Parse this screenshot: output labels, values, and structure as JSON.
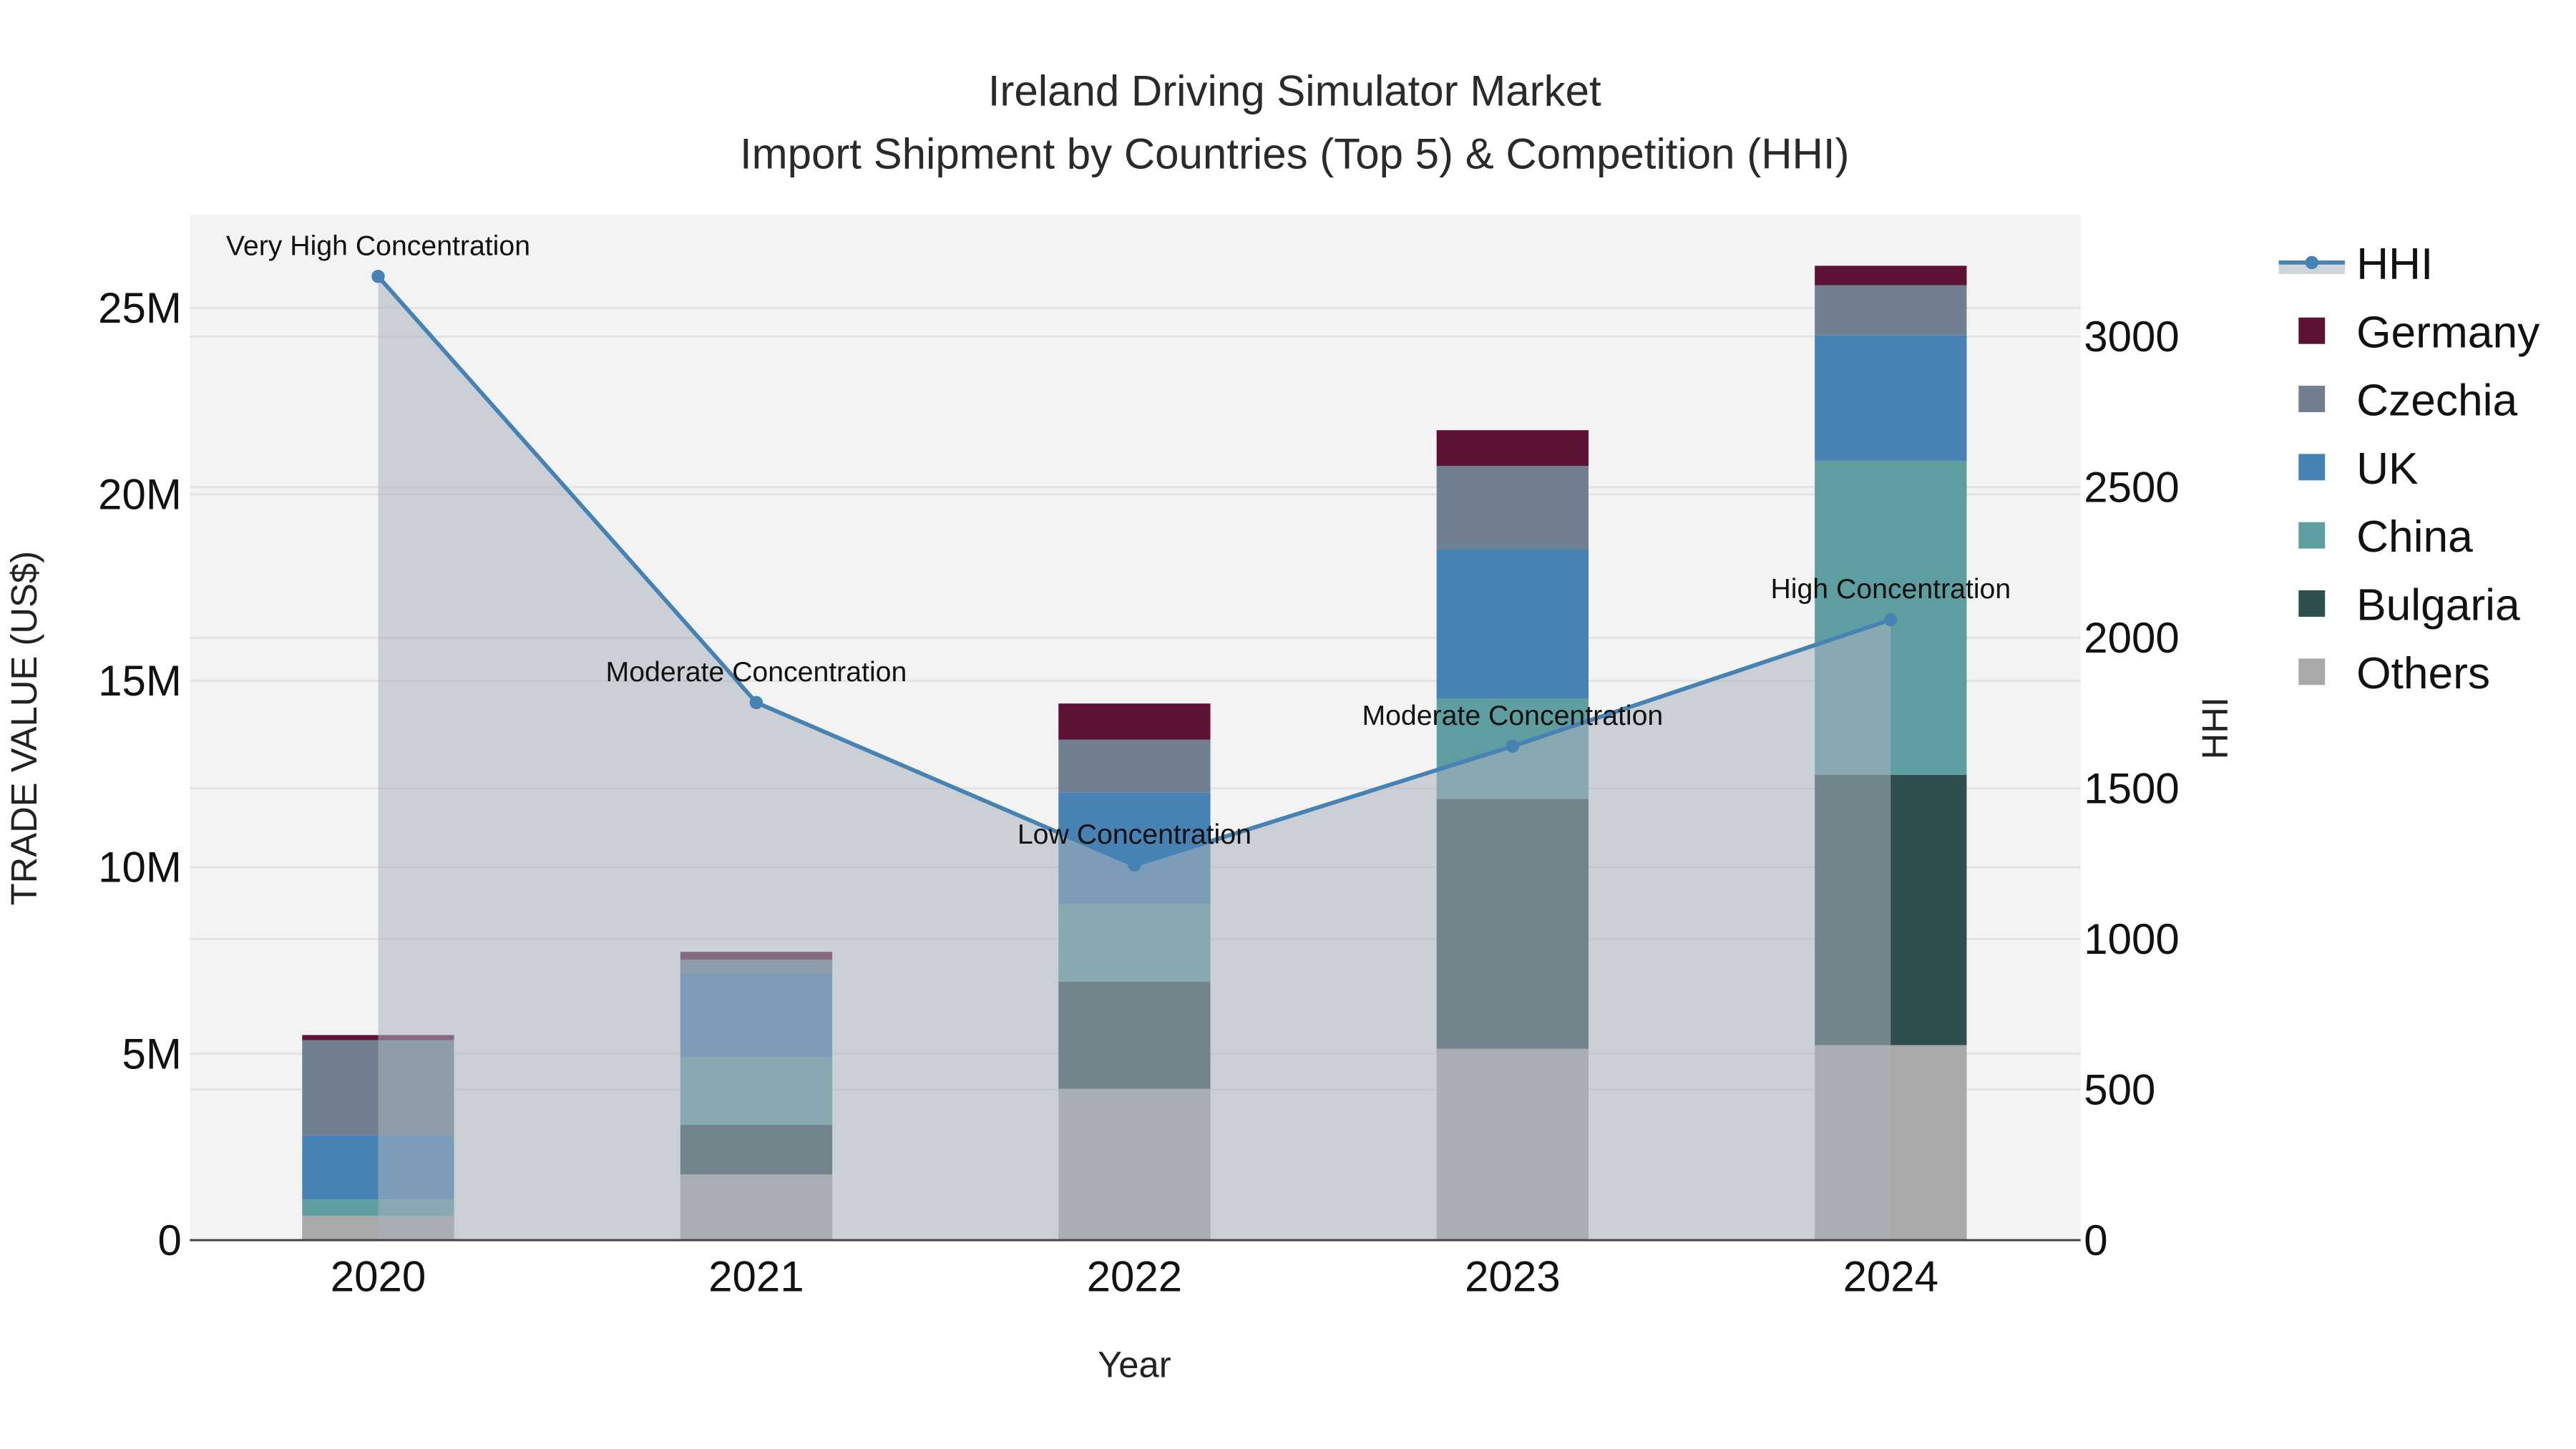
{
  "chart_data": {
    "type": "bar",
    "title": "Ireland Driving Simulator Market",
    "subtitle": "Import Shipment by Countries (Top 5) & Competition (HHI)",
    "xlabel": "Year",
    "ylabel": "TRADE VALUE (US$)",
    "y2label": "HHI",
    "categories": [
      "2020",
      "2021",
      "2022",
      "2023",
      "2024"
    ],
    "ylim": [
      0,
      27.5
    ],
    "y_unit": "M",
    "y_ticks": [
      0,
      5,
      10,
      15,
      20,
      25
    ],
    "y_tick_labels": [
      "0",
      "5M",
      "10M",
      "15M",
      "20M",
      "25M"
    ],
    "y2lim": [
      0,
      3405
    ],
    "y2_ticks": [
      0,
      500,
      1000,
      1500,
      2000,
      2500,
      3000
    ],
    "y2_tick_labels": [
      "0",
      "500",
      "1000",
      "1500",
      "2000",
      "2500",
      "3000"
    ],
    "stacked": true,
    "series": [
      {
        "name": "Others",
        "color": "#a9a9a9",
        "values": [
          0.65,
          1.76,
          4.06,
          5.13,
          5.23
        ]
      },
      {
        "name": "Bulgaria",
        "color": "#2f4f4f",
        "values": [
          0,
          1.33,
          2.87,
          6.7,
          7.25
        ]
      },
      {
        "name": "China",
        "color": "#5f9ea0",
        "values": [
          0.44,
          1.81,
          2.08,
          2.69,
          8.42
        ]
      },
      {
        "name": "UK",
        "color": "#4682b4",
        "values": [
          1.72,
          2.28,
          2.99,
          4.01,
          3.36
        ]
      },
      {
        "name": "Czechia",
        "color": "#708090",
        "values": [
          2.55,
          0.34,
          1.42,
          2.23,
          1.35
        ]
      },
      {
        "name": "Germany",
        "color": "#5e1336",
        "values": [
          0.14,
          0.21,
          0.97,
          0.96,
          0.52
        ]
      }
    ],
    "line": {
      "name": "HHI",
      "color": "#4682b4",
      "axis": "y2",
      "values": [
        3200,
        1785,
        1245,
        1640,
        2060
      ],
      "annotations": [
        "Very High Concentration",
        "Moderate Concentration",
        "Low Concentration",
        "Moderate Concentration",
        "High Concentration"
      ]
    },
    "legend": {
      "placement": "right",
      "items": [
        "HHI",
        "Germany",
        "Czechia",
        "UK",
        "China",
        "Bulgaria",
        "Others"
      ]
    },
    "grid": true
  }
}
